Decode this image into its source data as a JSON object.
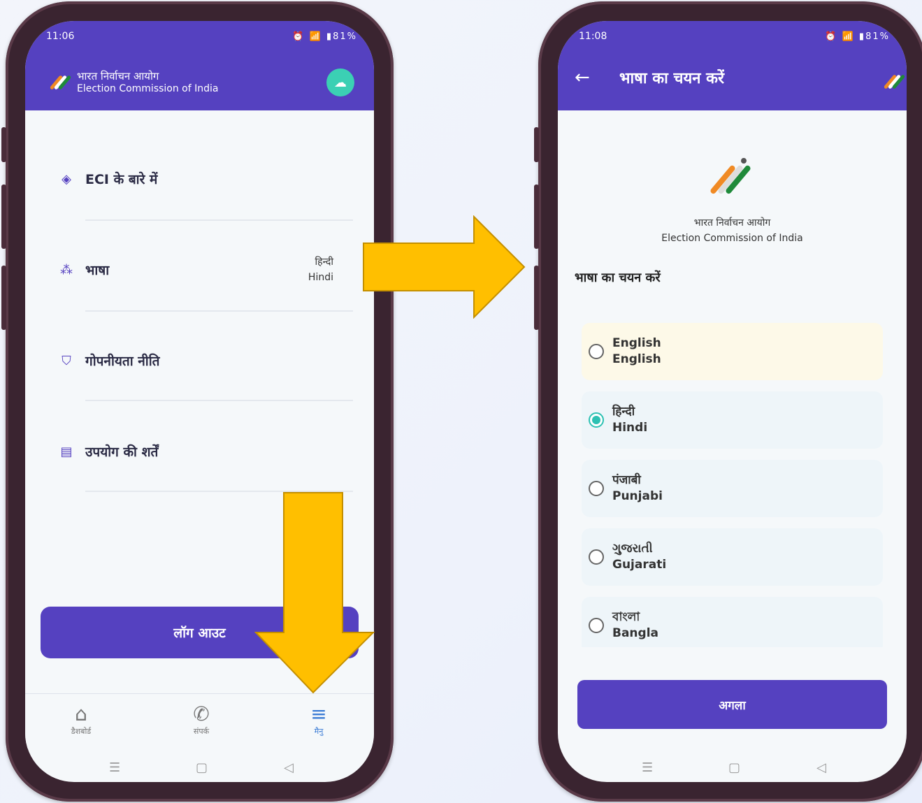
{
  "left_phone": {
    "status_time": "11:06",
    "status_right": "81%",
    "brand_hindi": "भारत निर्वाचन आयोग",
    "brand_english": "Election Commission of India",
    "menu": [
      {
        "label": "ECI के बारे में",
        "icon": "evm-icon"
      },
      {
        "label": "भाषा",
        "icon": "language-icon",
        "value_hindi": "हिन्दी",
        "value_english": "Hindi"
      },
      {
        "label": "गोपनीयता नीति",
        "icon": "shield-icon"
      },
      {
        "label": "उपयोग की शर्तें",
        "icon": "document-icon"
      }
    ],
    "logout_label": "लॉग आउट",
    "nav": [
      {
        "label": "डैशबोर्ड",
        "icon": "home-icon"
      },
      {
        "label": "संपर्क",
        "icon": "phone-icon"
      },
      {
        "label": "मैनु",
        "icon": "menu-icon"
      }
    ]
  },
  "right_phone": {
    "status_time": "11:08",
    "status_right": "81%",
    "title": "भाषा का चयन करें",
    "logo_caption_hindi": "भारत निर्वाचन आयोग",
    "logo_caption_english": "Election Commission of India",
    "section_title": "भाषा का चयन करें",
    "languages": [
      {
        "native": "English",
        "english": "English",
        "selected": false
      },
      {
        "native": "हिन्दी",
        "english": "Hindi",
        "selected": true
      },
      {
        "native": "पंजाबी",
        "english": "Punjabi",
        "selected": false
      },
      {
        "native": "ગુજરાતી",
        "english": "Gujarati",
        "selected": false
      },
      {
        "native": "বাংলা",
        "english": "Bangla",
        "selected": false
      }
    ],
    "next_label": "अगला"
  },
  "colors": {
    "primary": "#5541c0",
    "accent_arrow": "#ffbf00",
    "radio_selected": "#2dc1b3"
  }
}
